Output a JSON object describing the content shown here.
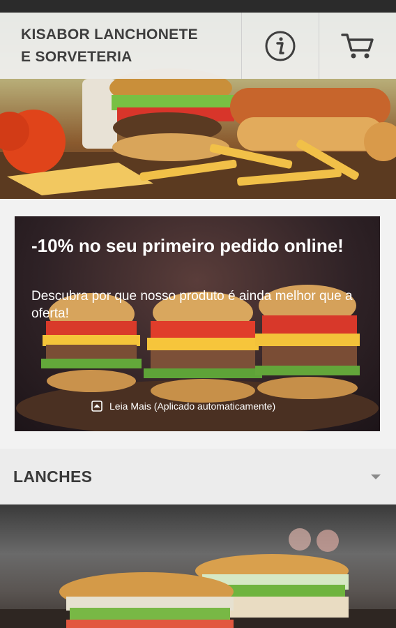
{
  "header": {
    "brand_line1": "KISABOR LANCHONETE",
    "brand_line2": "E SORVETERIA",
    "info_icon": "info-icon",
    "cart_icon": "cart-icon"
  },
  "promo": {
    "title": "-10% no seu primeiro pedido online!",
    "subtitle": "Descubra por que nosso produto é ainda melhor que a oferta!",
    "link_text": "Leia Mais (Aplicado automaticamente)",
    "link_icon": "expand-icon"
  },
  "menu_section": {
    "title": "LANCHES",
    "chevron_icon": "chevron-down-icon"
  },
  "colors": {
    "header_text": "#3e3e3e",
    "section_bg": "#ececec",
    "promo_text": "#ffffff"
  }
}
